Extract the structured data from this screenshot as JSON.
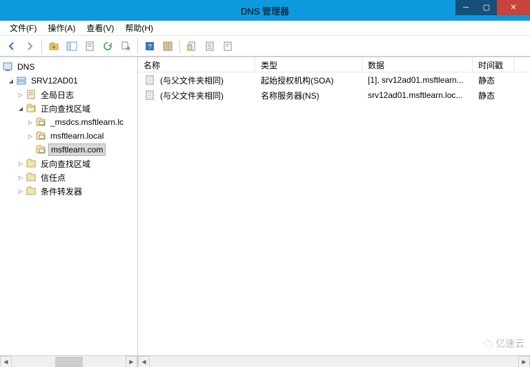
{
  "window": {
    "title": "DNS 管理器"
  },
  "menu": {
    "file": "文件(F)",
    "action": "操作(A)",
    "view": "查看(V)",
    "help": "帮助(H)"
  },
  "tree": {
    "root": "DNS",
    "server": "SRV12AD01",
    "global_log": "全局日志",
    "fwd_zones": "正向查找区域",
    "fwd": {
      "z0": "_msdcs.msftlearn.lc",
      "z1": "msftlearn.local",
      "z2": "msftlearn.com"
    },
    "rev_zones": "反向查找区域",
    "trust": "信任点",
    "cond_fwd": "条件转发器"
  },
  "columns": {
    "name": "名称",
    "type": "类型",
    "data": "数据",
    "timestamp": "时间戳"
  },
  "rows": {
    "r0": {
      "name": "(与父文件夹相同)",
      "type": "起始授权机构(SOA)",
      "data": "[1], srv12ad01.msftlearn...",
      "ts": "静态"
    },
    "r1": {
      "name": "(与父文件夹相同)",
      "type": "名称服务器(NS)",
      "data": "srv12ad01.msftlearn.loc...",
      "ts": "静态"
    }
  },
  "watermark": "亿速云"
}
